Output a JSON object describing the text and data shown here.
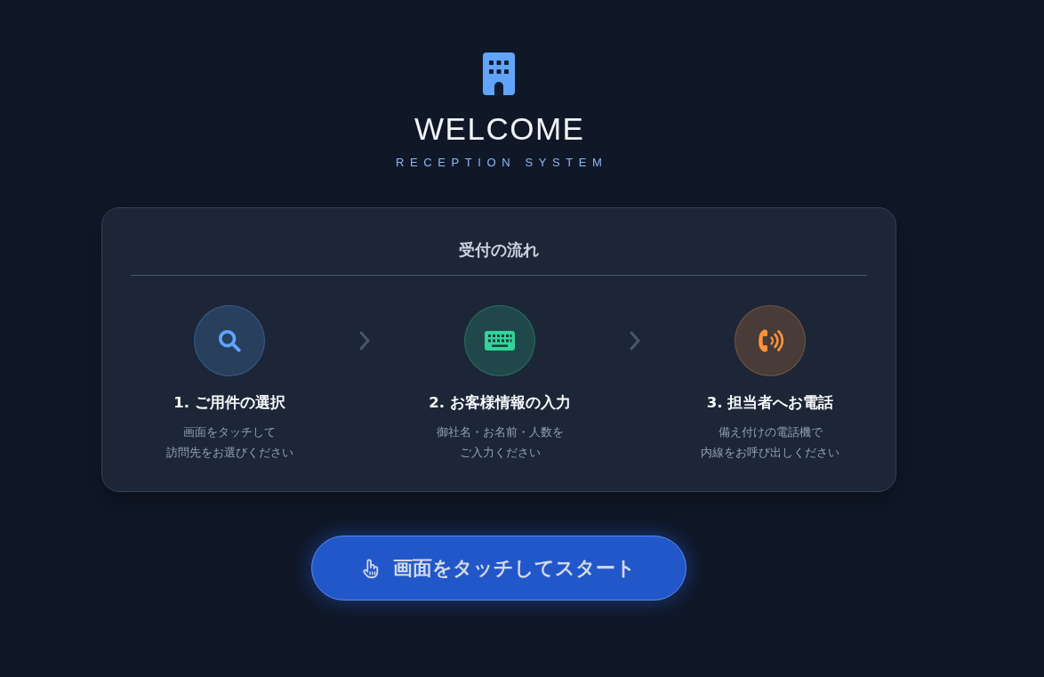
{
  "header": {
    "title": "WELCOME",
    "subtitle": "RECEPTION SYSTEM"
  },
  "flow": {
    "heading": "受付の流れ",
    "steps": [
      {
        "kind": "search",
        "color": "#60a5fa",
        "title": "1. ご用件の選択",
        "description_lines": [
          "画面をタッチして",
          "訪問先をお選びください"
        ]
      },
      {
        "kind": "keyboard",
        "color": "#34d399",
        "title": "2. お客様情報の入力",
        "description_lines": [
          "御社名・お名前・人数を",
          "ご入力ください"
        ]
      },
      {
        "kind": "phone",
        "color": "#fb923c",
        "title": "3. 担当者へお電話",
        "description_lines": [
          "備え付けの電話機で",
          "内線をお呼び出しください"
        ]
      }
    ]
  },
  "start_button": {
    "label": "画面をタッチしてスタート"
  }
}
